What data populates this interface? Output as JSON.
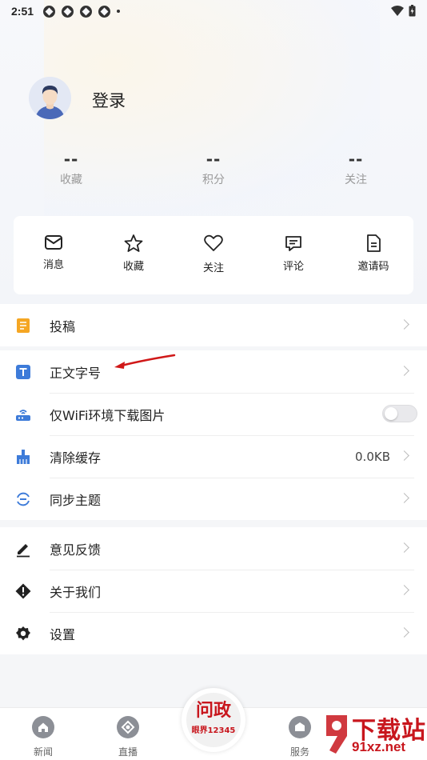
{
  "status_bar": {
    "time": "2:51"
  },
  "profile": {
    "login_label": "登录"
  },
  "stats": [
    {
      "value": "--",
      "label": "收藏"
    },
    {
      "value": "--",
      "label": "积分"
    },
    {
      "value": "--",
      "label": "关注"
    }
  ],
  "quick_actions": [
    {
      "label": "消息",
      "icon": "mail-icon"
    },
    {
      "label": "收藏",
      "icon": "star-icon"
    },
    {
      "label": "关注",
      "icon": "heart-icon"
    },
    {
      "label": "评论",
      "icon": "comment-icon"
    },
    {
      "label": "邀请码",
      "icon": "document-icon"
    }
  ],
  "menu": {
    "submit": {
      "label": "投稿"
    },
    "font_size": {
      "label": "正文字号"
    },
    "wifi_images": {
      "label": "仅WiFi环境下载图片",
      "enabled": false
    },
    "clear_cache": {
      "label": "清除缓存",
      "value": "0.0KB"
    },
    "sync_theme": {
      "label": "同步主题"
    },
    "feedback": {
      "label": "意见反馈"
    },
    "about": {
      "label": "关于我们"
    },
    "settings": {
      "label": "设置"
    }
  },
  "bottom_nav": {
    "news": "新闻",
    "live": "直播",
    "center_main": "问政",
    "center_sub": "眼界12345",
    "service": "服务"
  },
  "watermark": {
    "line1": "下载站",
    "line2": "91xz.net"
  },
  "colors": {
    "accent_red": "#c8161d",
    "icon_orange": "#f5a623",
    "icon_blue": "#3d7bd9"
  }
}
